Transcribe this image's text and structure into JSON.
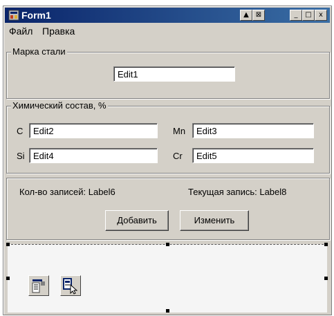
{
  "window": {
    "title": "Form1"
  },
  "titlebar_buttons": {
    "minimize": "_",
    "maximize": "□",
    "close": "x"
  },
  "menu": {
    "items": [
      "Файл",
      "Правка"
    ]
  },
  "grade_group": {
    "legend": "Марка стали",
    "edit": "Edit1"
  },
  "chem_group": {
    "legend": "Химический состав, %",
    "c_label": "C",
    "c_edit": "Edit2",
    "mn_label": "Mn",
    "mn_edit": "Edit3",
    "si_label": "Si",
    "si_edit": "Edit4",
    "cr_label": "Cr",
    "cr_edit": "Edit5"
  },
  "records": {
    "count_label": "Кол-во записей: Label6",
    "current_label": "Текущая запись: Label8",
    "add_button": "Добавить",
    "edit_button": "Изменить"
  }
}
